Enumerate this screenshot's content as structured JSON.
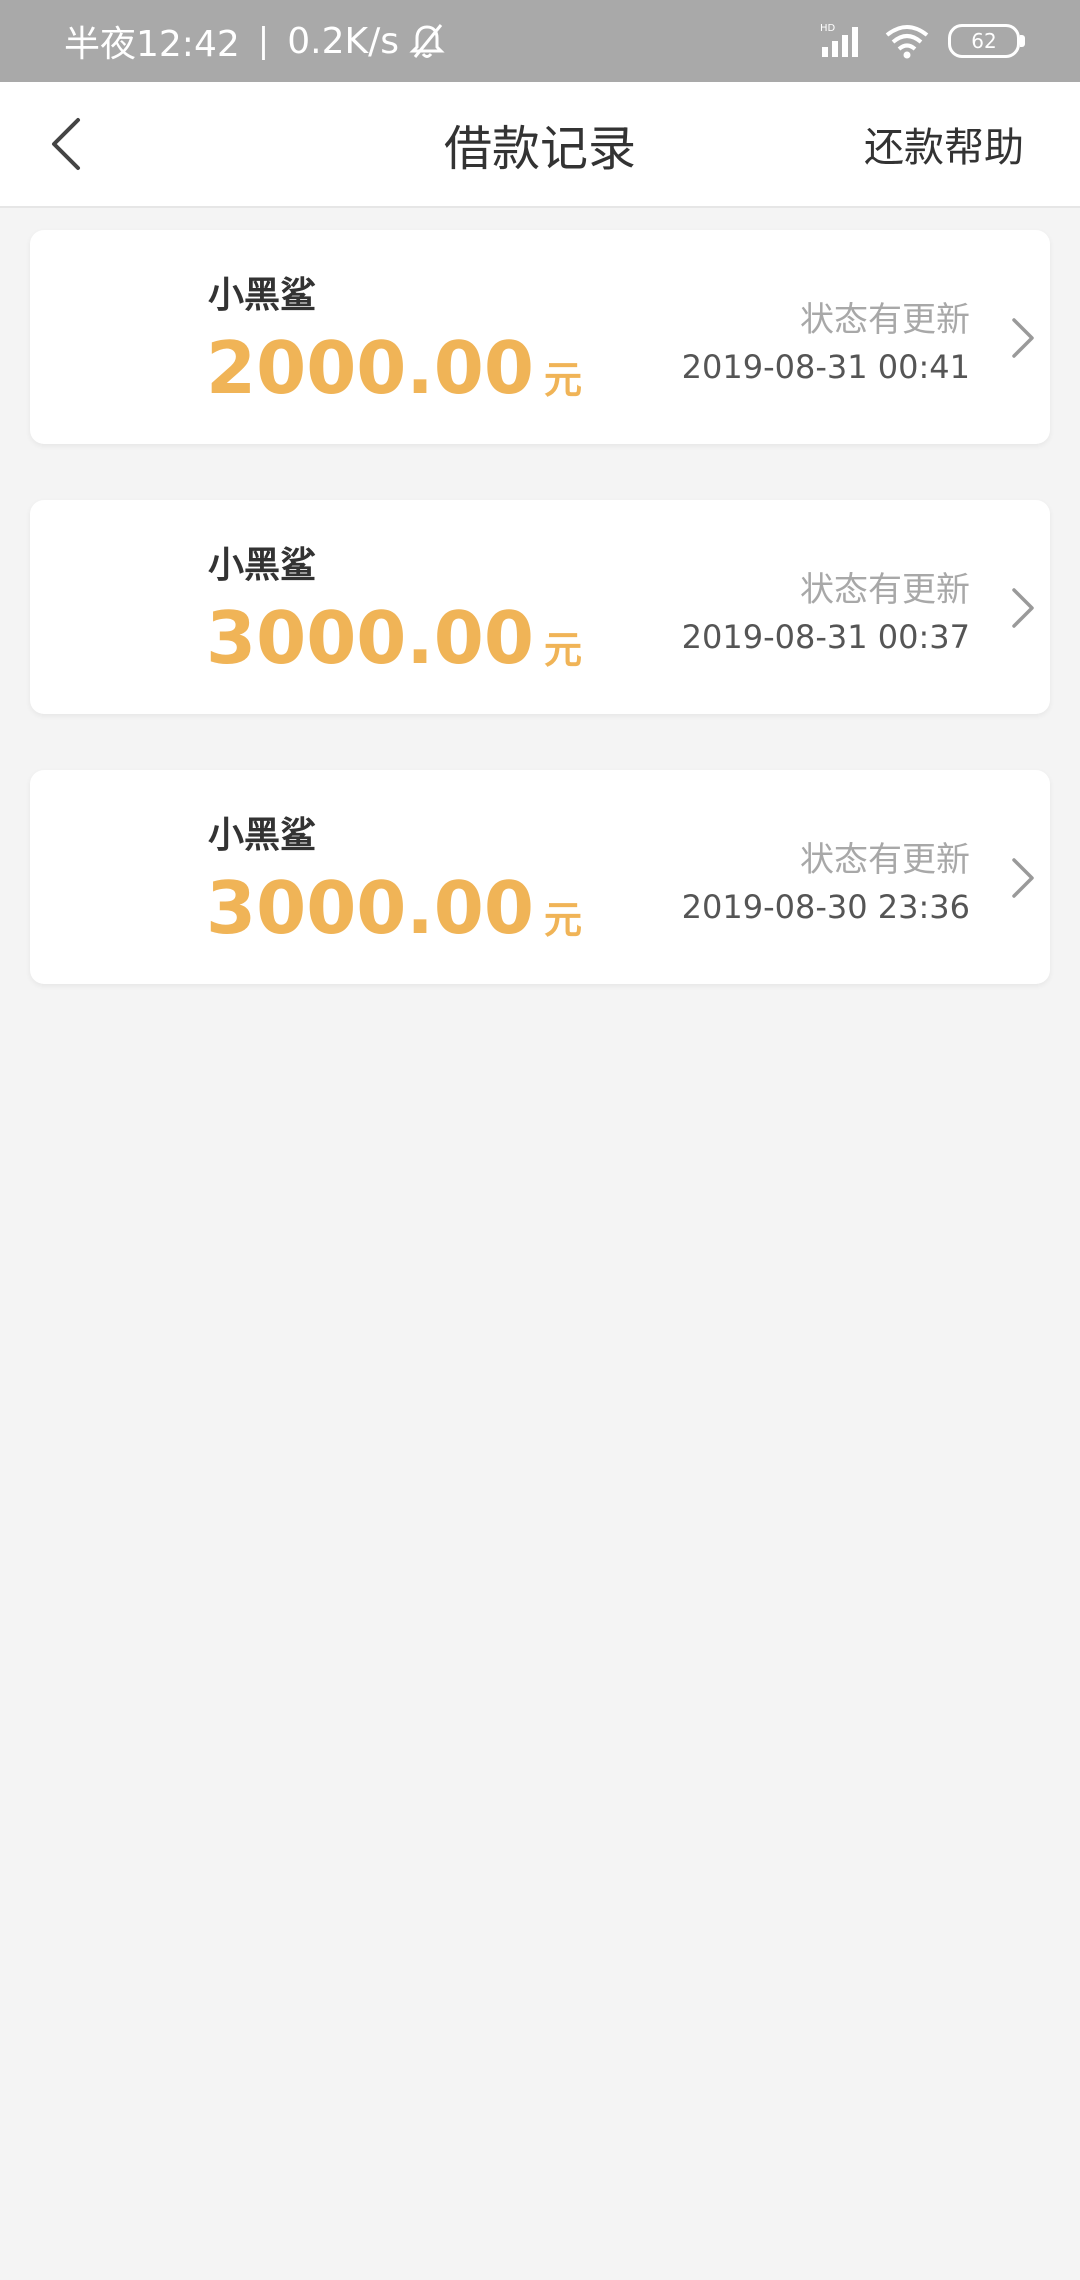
{
  "status_bar": {
    "time": "半夜12:42",
    "separator": "|",
    "speed": "0.2K/s",
    "signal_label": "HD",
    "battery": "62"
  },
  "header": {
    "title": "借款记录",
    "help": "还款帮助"
  },
  "records": [
    {
      "name": "小黑鲨",
      "amount": "2000.00",
      "unit": "元",
      "status": "状态有更新",
      "time": "2019-08-31 00:41"
    },
    {
      "name": "小黑鲨",
      "amount": "3000.00",
      "unit": "元",
      "status": "状态有更新",
      "time": "2019-08-31 00:37"
    },
    {
      "name": "小黑鲨",
      "amount": "3000.00",
      "unit": "元",
      "status": "状态有更新",
      "time": "2019-08-30 23:36"
    }
  ],
  "colors": {
    "accent": "#f0b457",
    "status_bar_bg": "#a9a9a9",
    "background": "#f4f4f4"
  }
}
